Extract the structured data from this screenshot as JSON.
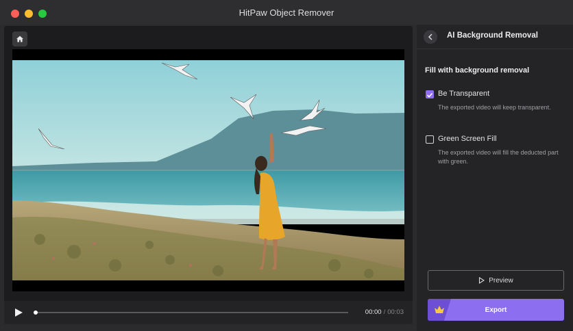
{
  "window": {
    "title": "HitPaw Object Remover"
  },
  "player": {
    "current_time": "00:00",
    "separator": "/",
    "total_time": "00:03",
    "progress": 0.0
  },
  "panel": {
    "title": "AI Background Removal",
    "section_title": "Fill with background removal",
    "options": [
      {
        "label": "Be Transparent",
        "description": "The exported video will keep transparent.",
        "checked": true
      },
      {
        "label": "Green Screen Fill",
        "description": "The exported video will fill the deducted part with green.",
        "checked": false
      }
    ],
    "preview_label": "Preview",
    "export_label": "Export"
  },
  "icons": {
    "home": "home-icon",
    "back": "chevron-left-icon",
    "play": "play-icon",
    "preview": "play-outline-icon",
    "export": "crown-icon"
  },
  "colors": {
    "accent": "#8c6ff0",
    "checkbox": "#8f6cf3"
  }
}
